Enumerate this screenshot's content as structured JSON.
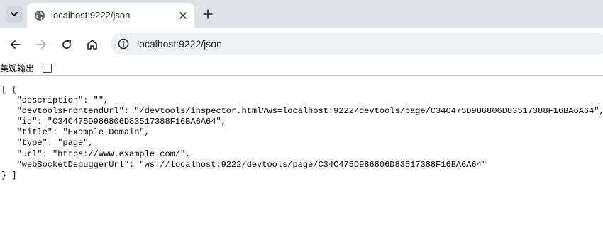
{
  "browser": {
    "tab": {
      "title": "localhost:9222/json",
      "icon": "globe-icon"
    },
    "toolbar": {
      "back_icon": "arrow-left-icon",
      "forward_icon": "arrow-right-icon",
      "reload_icon": "reload-icon",
      "home_icon": "home-icon",
      "site_info_icon": "info-icon",
      "url": "localhost:9222/json"
    }
  },
  "page": {
    "pretty_print_label": "美观输出",
    "pretty_print_checked": false,
    "json_lines": [
      "[ {",
      "   \"description\": \"\",",
      "   \"devtoolsFrontendUrl\": \"/devtools/inspector.html?ws=localhost:9222/devtools/page/C34C475D986806D83517388F16BA6A64\",",
      "   \"id\": \"C34C475D986806D83517388F16BA6A64\",",
      "   \"title\": \"Example Domain\",",
      "   \"type\": \"page\",",
      "   \"url\": \"https://www.example.com/\",",
      "   \"webSocketDebuggerUrl\": \"ws://localhost:9222/devtools/page/C34C475D986806D83517388F16BA6A64\"",
      "} ]"
    ]
  },
  "colors": {
    "tabstrip_bg": "#dfe3e8",
    "omnibox_bg": "#eef0f3",
    "text": "#1f1f1f"
  }
}
